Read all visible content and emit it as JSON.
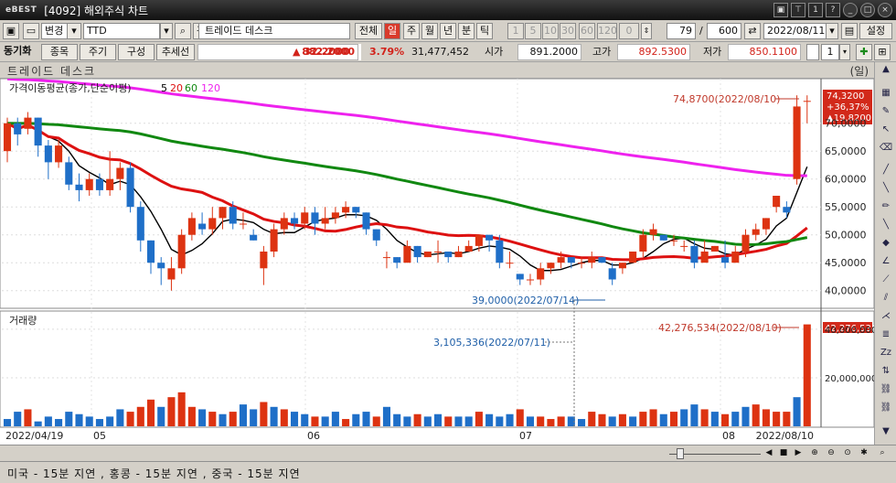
{
  "window": {
    "logo": "eBEST",
    "title": "[4092] 해외주식 차트",
    "buttons": [
      "▣",
      "⊤",
      "1",
      "?",
      "_",
      "□",
      "×"
    ]
  },
  "toolbar": {
    "mode_select": "변경",
    "symbol": "TTD",
    "relation_btn": "관",
    "company_name": "트레이드 데스크",
    "all_btn": "전체",
    "periods": [
      "일",
      "주",
      "월",
      "년",
      "분",
      "틱"
    ],
    "active_period": "일",
    "intervals": [
      "1",
      "5",
      "10",
      "30",
      "60",
      "120",
      "0"
    ],
    "count_value": "79",
    "total_count": "600",
    "date": "2022/08/11",
    "settings_btn": "설정"
  },
  "toolbar2": {
    "sync_label": "동기화",
    "buttons": [
      "종목",
      "주기",
      "구성",
      "추세선"
    ],
    "price": "882.2000",
    "change": "▲ 32.2000",
    "change_pct": "3.79%",
    "volume": "31,477,452",
    "open_label": "시가",
    "open": "891.2000",
    "high_label": "고가",
    "high": "892.5300",
    "low_label": "저가",
    "low": "850.1100",
    "page_num": "1"
  },
  "desk": {
    "title": "트레이드 데스크",
    "unit": "(일)"
  },
  "price_panel": {
    "legend_title": "가격이동평균(종가,단순이평)",
    "ma_labels": [
      "5",
      "20",
      "60",
      "120"
    ],
    "ma_colors": [
      "#000000",
      "#dd1111",
      "#118811",
      "#ee22ee"
    ],
    "y_ticks": [
      "70,0000",
      "65,0000",
      "60,0000",
      "55,0000",
      "50,0000",
      "45,0000",
      "40,0000"
    ],
    "annotation_high": "74,8700(2022/08/10)",
    "annotation_low": "39,0000(2022/07/14)",
    "current_box": [
      "74,3200",
      "+36,37%",
      "▲19,8200"
    ]
  },
  "volume_panel": {
    "title": "거래량",
    "y_ticks": [
      "40,000,000",
      "20,000,000"
    ],
    "annotation_high": "42,276,534(2022/08/10)",
    "annotation_mid": "3,105,336(2022/07/11)",
    "current_box": "42,276,534"
  },
  "x_axis": {
    "labels": [
      "2022/04/19",
      "05",
      "06",
      "07",
      "08",
      "2022/08/10"
    ]
  },
  "statusbar": {
    "text": "미국 - 15분 지연    , 홍콩 - 15분 지연    , 중국 - 15분 지연"
  },
  "chart_data": {
    "type": "candlestick",
    "up_color": "#dd3311",
    "down_color": "#1f6fc8",
    "ylim": [
      37,
      77
    ],
    "volume_ylim": [
      0,
      46
    ],
    "candles": [
      [
        65,
        70,
        71,
        63
      ],
      [
        70,
        68,
        71,
        66
      ],
      [
        69,
        71,
        72,
        68
      ],
      [
        71,
        66,
        71,
        64
      ],
      [
        66,
        63,
        67,
        60
      ],
      [
        63,
        66,
        67,
        62
      ],
      [
        63,
        59,
        64,
        58
      ],
      [
        59,
        58,
        61,
        56
      ],
      [
        58,
        60,
        61,
        57
      ],
      [
        60,
        58,
        61,
        57
      ],
      [
        58,
        60,
        65,
        57
      ],
      [
        60,
        62,
        63,
        58
      ],
      [
        62,
        55,
        63,
        54
      ],
      [
        55,
        49,
        56,
        47
      ],
      [
        49,
        45,
        49,
        43
      ],
      [
        45,
        44,
        46,
        41
      ],
      [
        42,
        44,
        46,
        40
      ],
      [
        44,
        50,
        51,
        43
      ],
      [
        50,
        53,
        54,
        49
      ],
      [
        52,
        51,
        54,
        50
      ],
      [
        51,
        53,
        55,
        50
      ],
      [
        53,
        55,
        55,
        51
      ],
      [
        55,
        52,
        56,
        51
      ],
      [
        52,
        52,
        54,
        51
      ],
      [
        50,
        49,
        51,
        49
      ],
      [
        44,
        47,
        48,
        41
      ],
      [
        47,
        51,
        52,
        46
      ],
      [
        51,
        53,
        54,
        50
      ],
      [
        53,
        52,
        54,
        51
      ],
      [
        52,
        54,
        55,
        51
      ],
      [
        54,
        52,
        55,
        50
      ],
      [
        52,
        53,
        55,
        51
      ],
      [
        53,
        54,
        55,
        52
      ],
      [
        54,
        55,
        56,
        53
      ],
      [
        55,
        54,
        55,
        53
      ],
      [
        54,
        51,
        54,
        50
      ],
      [
        51,
        49,
        51,
        48
      ],
      [
        46,
        46,
        47,
        44
      ],
      [
        46,
        45,
        46,
        44
      ],
      [
        45,
        48,
        49,
        45
      ],
      [
        48,
        46,
        48,
        45
      ],
      [
        46,
        47,
        47,
        46
      ],
      [
        47,
        47,
        49,
        45
      ],
      [
        47,
        46,
        47,
        45
      ],
      [
        46,
        47,
        48,
        46
      ],
      [
        47,
        48,
        49,
        47
      ],
      [
        48,
        50,
        50,
        47
      ],
      [
        50,
        49,
        50,
        47
      ],
      [
        49,
        45,
        50,
        44
      ],
      [
        45,
        45,
        47,
        44
      ],
      [
        43,
        42,
        43,
        41
      ],
      [
        42,
        42,
        43,
        41
      ],
      [
        42,
        44,
        45,
        41
      ],
      [
        44,
        45,
        45,
        43
      ],
      [
        45,
        46,
        47,
        44
      ],
      [
        46,
        45,
        46,
        44
      ],
      [
        45,
        45,
        46,
        44
      ],
      [
        45,
        46,
        47,
        44
      ],
      [
        46,
        45,
        46,
        45
      ],
      [
        44,
        42,
        45,
        41
      ],
      [
        44,
        45,
        45,
        43
      ],
      [
        45,
        47,
        47,
        45
      ],
      [
        47,
        50,
        51,
        46
      ],
      [
        50,
        51,
        52,
        49
      ],
      [
        50,
        49,
        50,
        49
      ],
      [
        49,
        49,
        50,
        48
      ],
      [
        48,
        48,
        49,
        47
      ],
      [
        48,
        45,
        49,
        44
      ],
      [
        45,
        47,
        49,
        46
      ],
      [
        47,
        48,
        48,
        47
      ],
      [
        46,
        45,
        49,
        44
      ],
      [
        45,
        47,
        48,
        45
      ],
      [
        47,
        50,
        51,
        46
      ],
      [
        50,
        51,
        52,
        49
      ],
      [
        51,
        53,
        53,
        50
      ],
      [
        55,
        57,
        57,
        54
      ],
      [
        55,
        54,
        56,
        53
      ],
      [
        60,
        73,
        75,
        59
      ],
      [
        74,
        74,
        75,
        70
      ]
    ],
    "volume": [
      [
        3,
        0
      ],
      [
        6,
        0
      ],
      [
        7,
        1
      ],
      [
        2,
        0
      ],
      [
        4,
        0
      ],
      [
        3,
        0
      ],
      [
        6,
        0
      ],
      [
        5,
        0
      ],
      [
        4,
        0
      ],
      [
        3,
        0
      ],
      [
        4,
        0
      ],
      [
        7,
        0
      ],
      [
        6,
        1
      ],
      [
        8,
        1
      ],
      [
        11,
        1
      ],
      [
        8,
        0
      ],
      [
        12,
        1
      ],
      [
        14,
        1
      ],
      [
        8,
        1
      ],
      [
        7,
        0
      ],
      [
        6,
        1
      ],
      [
        5,
        0
      ],
      [
        6,
        1
      ],
      [
        9,
        0
      ],
      [
        7,
        0
      ],
      [
        10,
        1
      ],
      [
        8,
        0
      ],
      [
        7,
        1
      ],
      [
        6,
        0
      ],
      [
        5,
        0
      ],
      [
        4,
        1
      ],
      [
        4,
        0
      ],
      [
        6,
        0
      ],
      [
        3,
        1
      ],
      [
        5,
        0
      ],
      [
        6,
        0
      ],
      [
        4,
        1
      ],
      [
        8,
        0
      ],
      [
        5,
        0
      ],
      [
        4,
        0
      ],
      [
        5,
        1
      ],
      [
        4,
        0
      ],
      [
        5,
        0
      ],
      [
        4,
        1
      ],
      [
        4,
        0
      ],
      [
        4,
        0
      ],
      [
        6,
        1
      ],
      [
        5,
        0
      ],
      [
        4,
        0
      ],
      [
        5,
        0
      ],
      [
        7,
        1
      ],
      [
        4,
        0
      ],
      [
        4,
        1
      ],
      [
        3,
        1
      ],
      [
        4,
        1
      ],
      [
        4,
        0
      ],
      [
        3,
        0
      ],
      [
        6,
        1
      ],
      [
        5,
        1
      ],
      [
        4,
        0
      ],
      [
        5,
        1
      ],
      [
        4,
        0
      ],
      [
        6,
        1
      ],
      [
        7,
        1
      ],
      [
        5,
        0
      ],
      [
        6,
        1
      ],
      [
        7,
        0
      ],
      [
        9,
        0
      ],
      [
        7,
        1
      ],
      [
        6,
        0
      ],
      [
        5,
        1
      ],
      [
        6,
        0
      ],
      [
        8,
        0
      ],
      [
        9,
        1
      ],
      [
        7,
        1
      ],
      [
        6,
        1
      ],
      [
        6,
        1
      ],
      [
        12,
        0
      ],
      [
        42,
        1
      ]
    ]
  }
}
